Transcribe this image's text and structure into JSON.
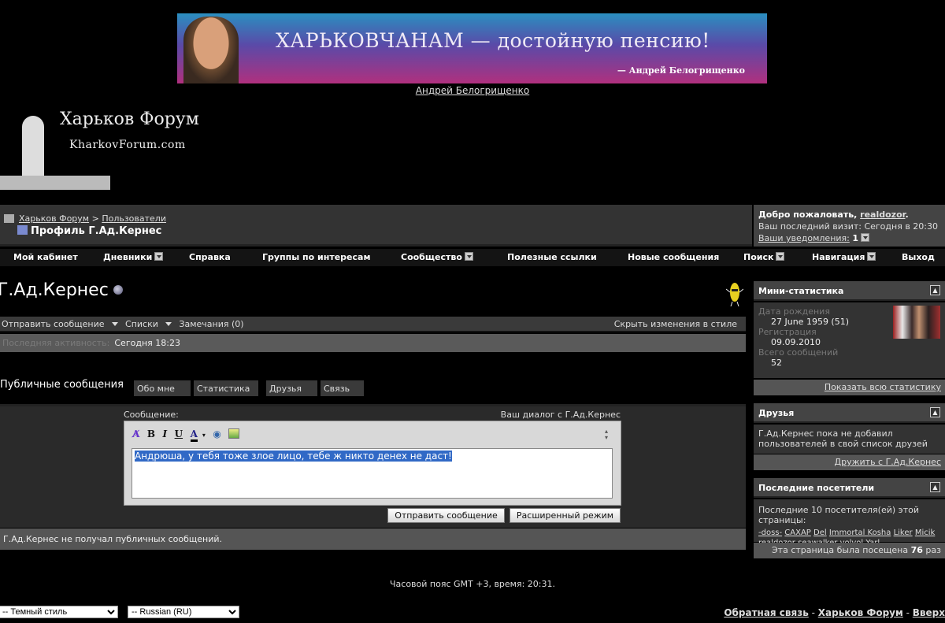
{
  "banner": {
    "headline": "ХАРЬКОВЧАНАМ  —  достойную пенсию!",
    "signature": "— Андрей Белогрищенко",
    "link": "Андрей Белогрищенко"
  },
  "logo": {
    "title": "Харьков Форум",
    "subtitle": "KharkovForum.com"
  },
  "breadcrumb": {
    "home": "Харьков Форум",
    "sep": ">",
    "section": "Пользователи",
    "title": "Профиль Г.Ад.Кернес"
  },
  "welcome": {
    "greeting": "Добро пожаловать, ",
    "user": "realdozor",
    "dot": ".",
    "last_visit": "Ваш последний визит: Сегодня в 20:30",
    "notifications": "Ваши уведомления:",
    "notif_count": "1"
  },
  "nav": [
    "Мой кабинет",
    "Дневники",
    "Справка",
    "Группы по интересам",
    "Сообщество",
    "Полезные ссылки",
    "Новые сообщения",
    "Поиск",
    "Навигация",
    "Выход"
  ],
  "profile": {
    "name": "Г.Ад.Кернес",
    "send_message": "Отправить сообщение",
    "lists": "Списки",
    "notes": "Замечания (0)",
    "hide_style": "Скрыть изменения в стиле",
    "last_activity_label": "Последняя активность:",
    "last_activity": "Сегодня 18:23"
  },
  "tabs": [
    "Публичные сообщения",
    "Обо мне",
    "Статистика",
    "Друзья",
    "Связь"
  ],
  "editor": {
    "label": "Сообщение:",
    "dialog": "Ваш диалог с Г.Ад.Кернес",
    "text": "Андрюша, у тебя тоже злое лицо, тебе ж никто денех не даст!",
    "submit": "Отправить сообщение",
    "advanced": "Расширенный режим",
    "no_messages": "Г.Ад.Кернес не получал публичных сообщений."
  },
  "sidebar": {
    "stats": {
      "title": "Мини-статистика",
      "birth_label": "Дата рождения",
      "birth": "27 June 1959 (51)",
      "reg_label": "Регистрация",
      "reg": "09.09.2010",
      "posts_label": "Всего сообщений",
      "posts": "52",
      "footer": "Показать всю статистику"
    },
    "friends": {
      "title": "Друзья",
      "text": "Г.Ад.Кернес пока не добавил пользователей в свой список друзей",
      "footer": "Дружить с Г.Ад.Кернес"
    },
    "visitors": {
      "title": "Последние посетители",
      "text": "Последние 10 посетителя(ей) этой страницы:",
      "users": [
        "-doss-",
        "CAXAP",
        "Del",
        "Immortal Kosha",
        "Liker",
        "Micik",
        "realdozor",
        "seawalker",
        "volvol",
        "Yarl"
      ],
      "footer_pre": "Эта страница была посещена",
      "count": "76",
      "footer_post": "раз"
    }
  },
  "footer": {
    "timezone": "Часовой пояс GMT +3, время: 20:31.",
    "style": "-- Темный стиль",
    "language": "-- Russian (RU)",
    "links": [
      "Обратная связь",
      "Харьков Форум",
      "Вверх"
    ],
    "sep": " - "
  }
}
